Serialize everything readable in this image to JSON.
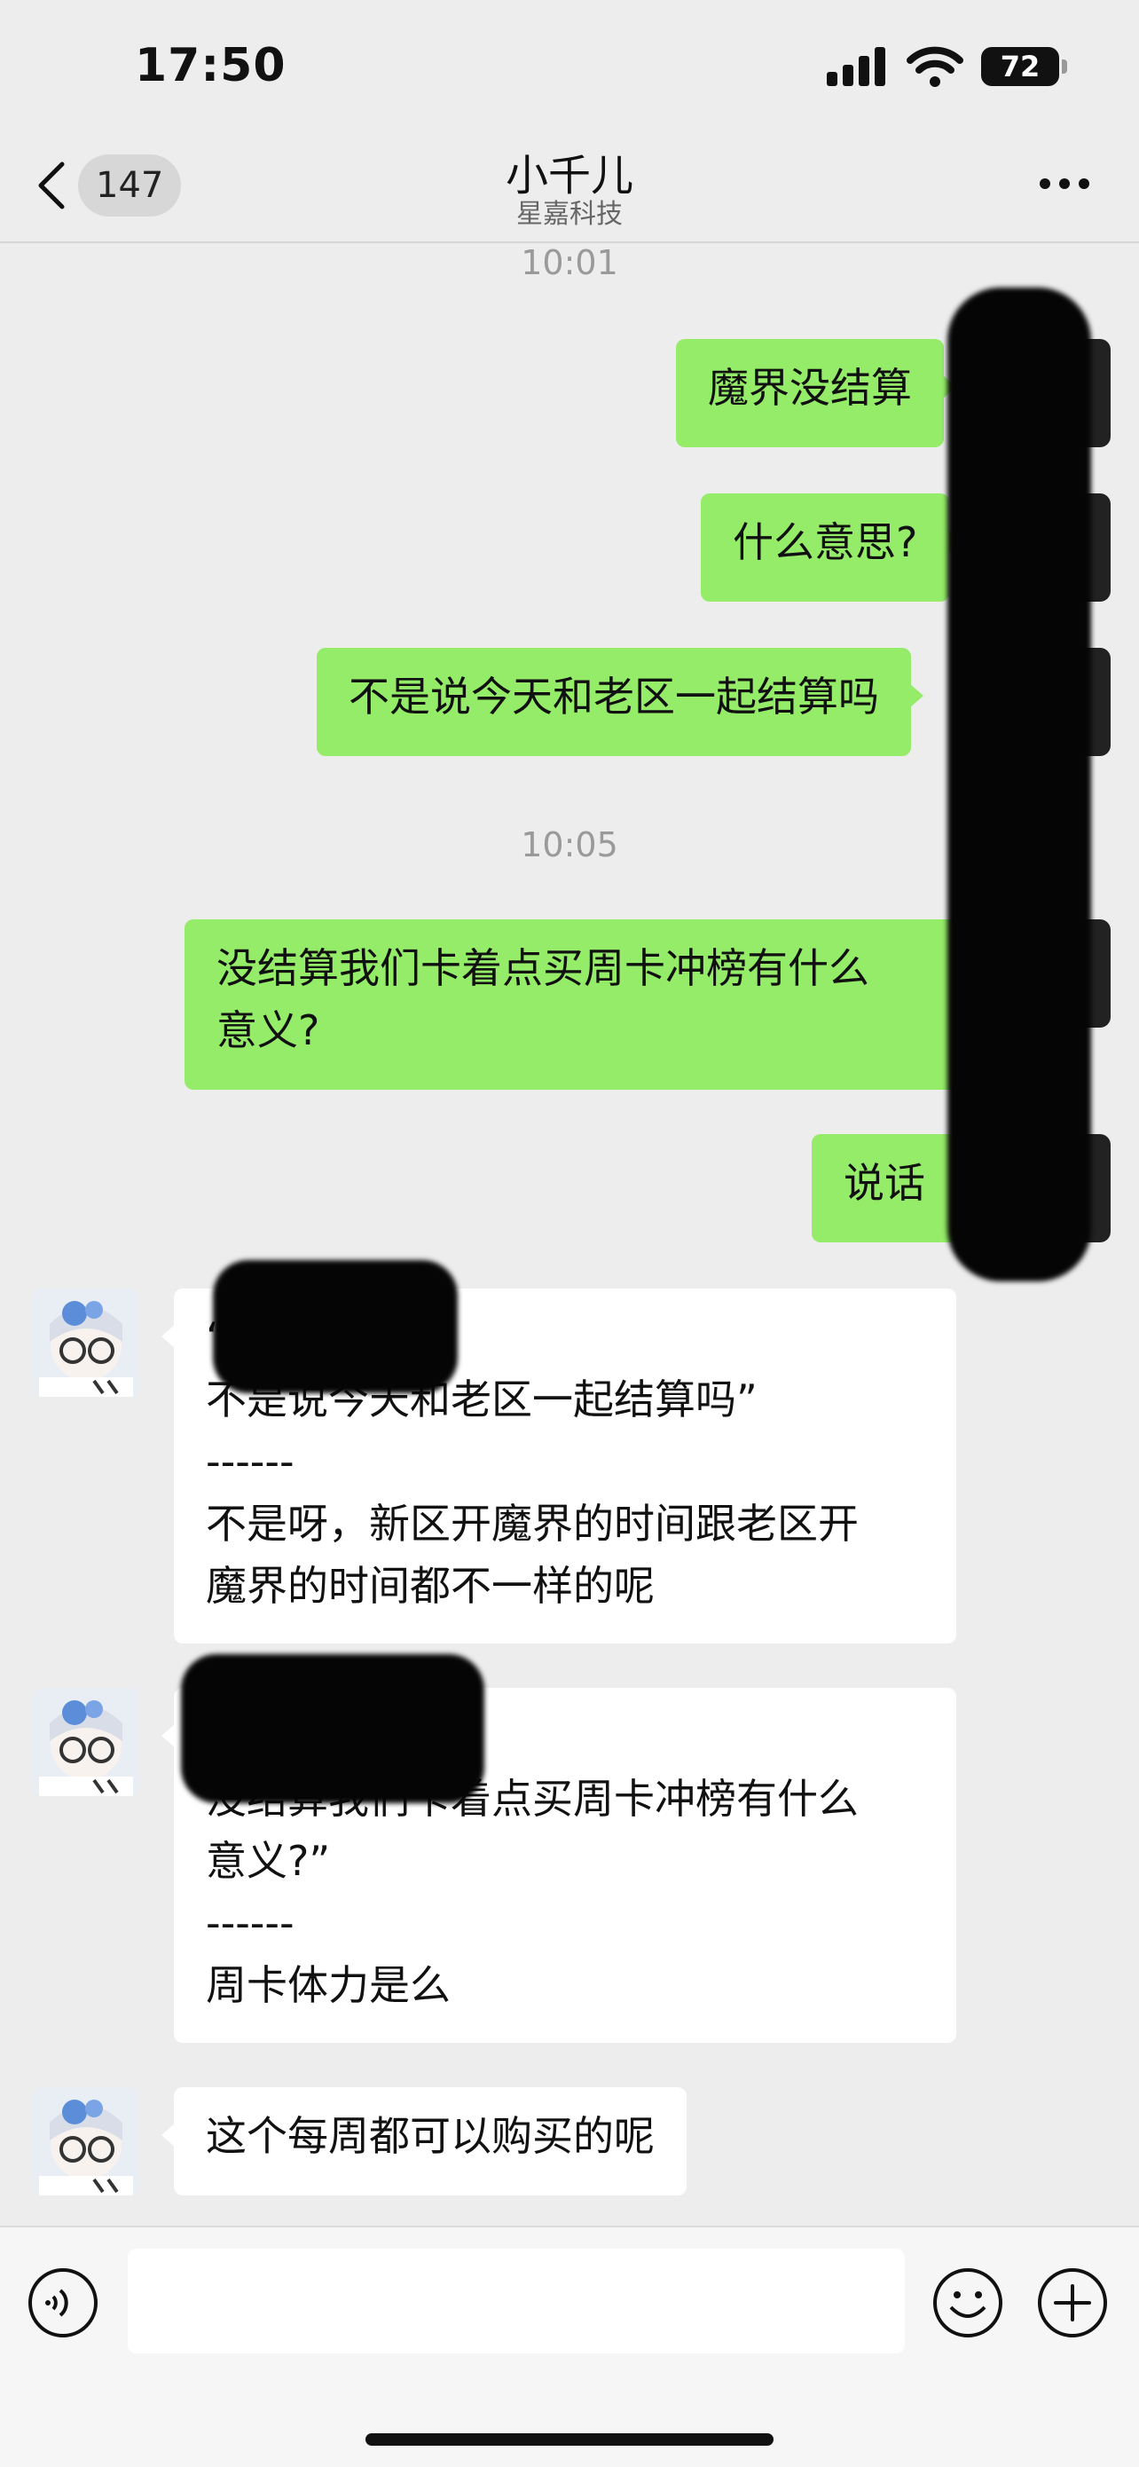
{
  "status_bar": {
    "time": "17:50",
    "battery": "72"
  },
  "nav": {
    "back_badge": "147",
    "title": "小千儿",
    "subtitle": "星嘉科技",
    "icons": {
      "back": "chevron-left-icon",
      "more": "more-dots-icon"
    }
  },
  "chat": {
    "timestamps": [
      "10:01",
      "10:05"
    ],
    "messages": [
      {
        "direction": "out",
        "text": "魔界没结算"
      },
      {
        "direction": "out",
        "text": "什么意思?"
      },
      {
        "direction": "out",
        "text": "不是说今天和老区一起结算吗"
      },
      {
        "direction": "out",
        "text": "没结算我们卡着点买周卡冲榜有什么\n意义?"
      },
      {
        "direction": "out",
        "text": "说话"
      },
      {
        "direction": "in",
        "text": "“好的呢:\n不是说今天和老区一起结算吗”\n------\n不是呀，新区开魔界的时间跟老区开\n魔界的时间都不一样的呢"
      },
      {
        "direction": "in",
        "text": "“好的呢:\n没结算我们卡着点买周卡冲榜有什么\n意义?”\n------\n周卡体力是么"
      },
      {
        "direction": "in",
        "text": "这个每周都可以购买的呢"
      }
    ]
  },
  "input_bar": {
    "placeholder": "",
    "icons": {
      "voice": "voice-icon",
      "emoji": "emoji-icon",
      "plus": "plus-icon"
    }
  },
  "colors": {
    "outgoing_bubble": "#95ec69",
    "incoming_bubble": "#ffffff",
    "background": "#ededed"
  }
}
